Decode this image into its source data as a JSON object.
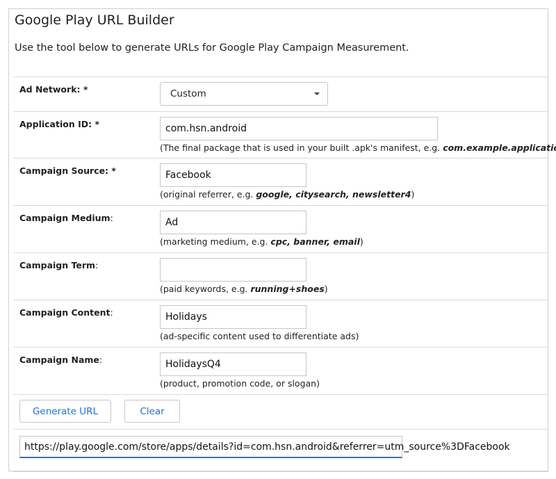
{
  "header": {
    "title": "Google Play URL Builder",
    "subtitle": "Use the tool below to generate URLs for Google Play Campaign Measurement."
  },
  "fields": {
    "ad_network": {
      "label": "Ad Network: *",
      "value": "Custom"
    },
    "application_id": {
      "label": "Application ID: *",
      "value": "com.hsn.android",
      "hint_prefix": "(The final package that is used in your built .apk's manifest, e.g. ",
      "hint_example": "com.example.application",
      "hint_suffix": ")"
    },
    "campaign_source": {
      "label": "Campaign Source: *",
      "value": "Facebook",
      "hint_prefix": "(original referrer, e.g. ",
      "hint_example": "google, citysearch, newsletter4",
      "hint_suffix": ")"
    },
    "campaign_medium": {
      "label": "Campaign Medium",
      "value": "Ad",
      "hint_prefix": "(marketing medium, e.g. ",
      "hint_example": "cpc, banner, email",
      "hint_suffix": ")"
    },
    "campaign_term": {
      "label": "Campaign Term",
      "value": "",
      "hint_prefix": "(paid keywords, e.g. ",
      "hint_example": "running+shoes",
      "hint_suffix": ")"
    },
    "campaign_content": {
      "label": "Campaign Content",
      "value": "Holidays",
      "hint": "(ad-specific content used to differentiate ads)"
    },
    "campaign_name": {
      "label": "Campaign Name",
      "value": "HolidaysQ4",
      "hint": "(product, promotion code, or slogan)"
    }
  },
  "buttons": {
    "generate_label": "Generate URL",
    "clear_label": "Clear"
  },
  "output": {
    "url": "https://play.google.com/store/apps/details?id=com.hsn.android&referrer=utm_source%3DFacebook"
  },
  "colors": {
    "accent": "#1a73e8",
    "border": "#c6c6c6",
    "divider": "#dadada"
  }
}
